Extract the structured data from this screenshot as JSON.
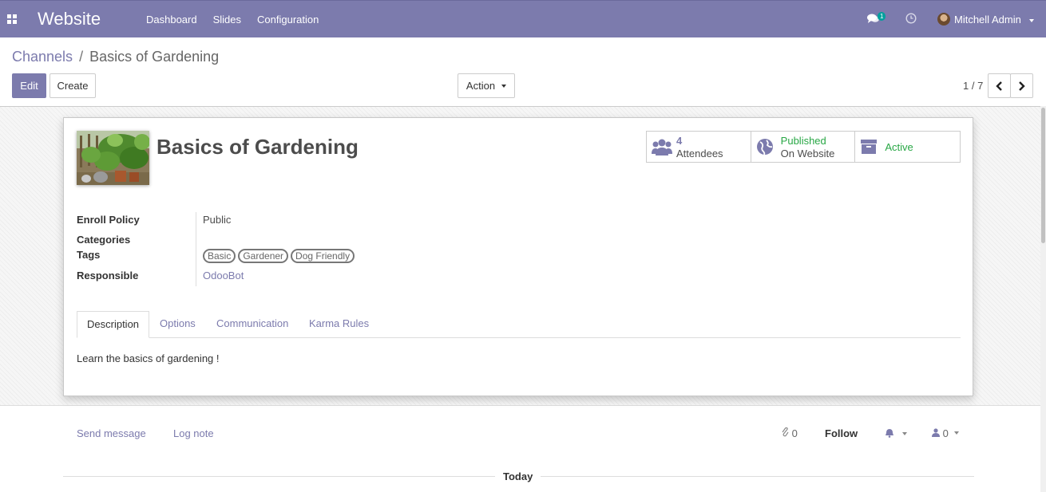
{
  "navbar": {
    "brand": "Website",
    "menu": [
      "Dashboard",
      "Slides",
      "Configuration"
    ],
    "chat_count": "1",
    "user": "Mitchell Admin",
    "colors": {
      "primary": "#7c7bad",
      "badge": "#00a09d"
    }
  },
  "breadcrumb": {
    "parent": "Channels",
    "separator": "/",
    "current": "Basics of Gardening"
  },
  "buttons": {
    "edit": "Edit",
    "create": "Create",
    "action": "Action"
  },
  "pager": {
    "value": "1 / 7"
  },
  "record": {
    "title": "Basics of Gardening",
    "stats": {
      "attendees_count": "4",
      "attendees_label": "Attendees",
      "published_status": "Published",
      "published_label": "On Website",
      "active_label": "Active"
    },
    "fields": {
      "enroll_policy_label": "Enroll Policy",
      "enroll_policy_value": "Public",
      "categories_label": "Categories",
      "tags_label": "Tags",
      "tags": [
        "Basic",
        "Gardener",
        "Dog Friendly"
      ],
      "responsible_label": "Responsible",
      "responsible_value": "OdooBot"
    },
    "tabs": [
      "Description",
      "Options",
      "Communication",
      "Karma Rules"
    ],
    "active_tab": "Description",
    "description": "Learn the basics of gardening !"
  },
  "chatter": {
    "send_message": "Send message",
    "log_note": "Log note",
    "attachments": "0",
    "follow": "Follow",
    "followers": "0",
    "date_separator": "Today"
  }
}
